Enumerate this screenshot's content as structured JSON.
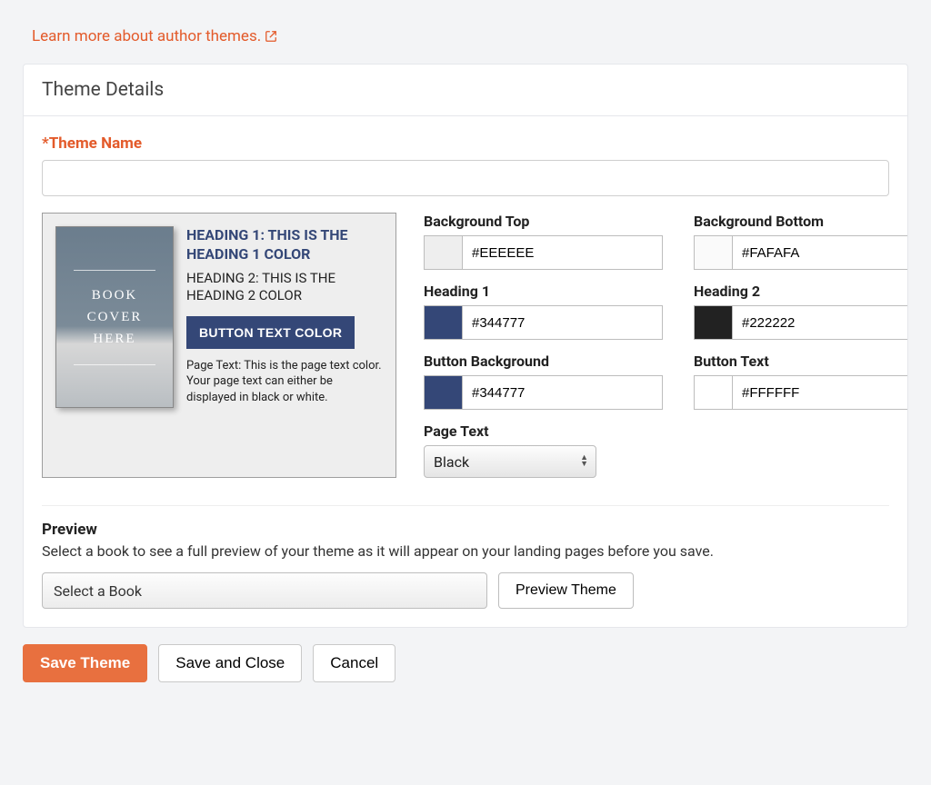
{
  "learn_more": {
    "text": "Learn more about author themes."
  },
  "card": {
    "title": "Theme Details",
    "theme_name_label": "*Theme Name",
    "theme_name_value": ""
  },
  "cover": {
    "line1": "BOOK COVER",
    "line2": "HERE"
  },
  "preview": {
    "h1": "HEADING 1: THIS IS THE HEADING 1 COLOR",
    "h2": "HEADING 2: THIS IS THE HEADING 2 COLOR",
    "button": "BUTTON TEXT COLOR",
    "page_text": "Page Text: This is the page text color. Your page text can either be displayed in black or white."
  },
  "controls": {
    "bg_top": {
      "label": "Background Top",
      "value": "#EEEEEE"
    },
    "bg_bot": {
      "label": "Background Bottom",
      "value": "#FAFAFA"
    },
    "h1": {
      "label": "Heading 1",
      "value": "#344777"
    },
    "h2": {
      "label": "Heading 2",
      "value": "#222222"
    },
    "btn_bg": {
      "label": "Button Background",
      "value": "#344777"
    },
    "btn_text": {
      "label": "Button Text",
      "value": "#FFFFFF"
    },
    "page_text": {
      "label": "Page Text",
      "value": "Black"
    }
  },
  "preview_section": {
    "title": "Preview",
    "subtitle": "Select a book to see a full preview of your theme as it will appear on your landing pages before you save.",
    "select_placeholder": "Select a Book",
    "preview_button": "Preview Theme"
  },
  "actions": {
    "save": "Save Theme",
    "save_close": "Save and Close",
    "cancel": "Cancel"
  }
}
